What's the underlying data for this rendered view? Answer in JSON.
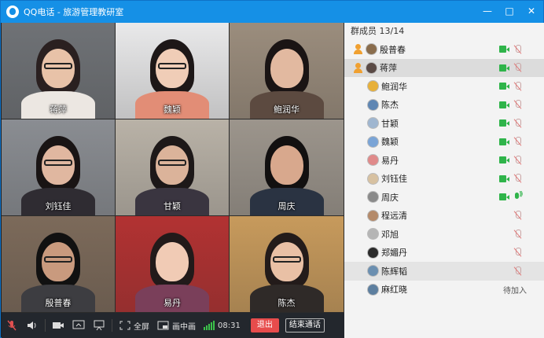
{
  "window": {
    "title": "QQ电话 - 旅游管理教研室",
    "minimize_label": "—",
    "maximize_label": "□",
    "close_label": "✕"
  },
  "tiles": [
    {
      "name": "蒋萍",
      "bg": "#6f7276",
      "skin": "#e8c2a8",
      "hair": "#2a2020",
      "shirt": "#ece7e2",
      "glasses": true
    },
    {
      "name": "魏颖",
      "bg": "#e9e9ea",
      "skin": "#f0cdb7",
      "hair": "#1d1717",
      "shirt": "#e28d76",
      "glasses": true
    },
    {
      "name": "鲍润华",
      "bg": "#9b8d7d",
      "skin": "#e2b9a0",
      "hair": "#1a1414",
      "shirt": "#5c4a40",
      "glasses": false
    },
    {
      "name": "刘钰佳",
      "bg": "#8a8d92",
      "skin": "#e0b7a0",
      "hair": "#191414",
      "shirt": "#2f2c32",
      "glasses": true
    },
    {
      "name": "甘颖",
      "bg": "#b9b2a7",
      "skin": "#dbb39a",
      "hair": "#1d1818",
      "shirt": "#3a3540",
      "glasses": true
    },
    {
      "name": "周庆",
      "bg": "#9c958c",
      "skin": "#d8a88d",
      "hair": "#121010",
      "shirt": "#2a3342",
      "glasses": false
    },
    {
      "name": "殷普春",
      "bg": "#7c6a5a",
      "skin": "#c99a7e",
      "hair": "#111",
      "shirt": "#3d3d41",
      "glasses": true
    },
    {
      "name": "易丹",
      "bg": "#b23232",
      "skin": "#f1cbb5",
      "hair": "#221a1a",
      "shirt": "#7a3f5a",
      "glasses": false
    },
    {
      "name": "陈杰",
      "bg": "#c79a5c",
      "skin": "#e9c0a5",
      "hair": "#231b1a",
      "shirt": "#2f2a28",
      "glasses": true
    }
  ],
  "toolbar": {
    "fullscreen_label": "全屏",
    "pip_label": "画中画",
    "time": "08:31",
    "exit_label": "退出",
    "end_label": "结束通话"
  },
  "panel": {
    "header": "群成员 13/14",
    "members": [
      {
        "name": "殷普春",
        "host": true,
        "cam": true,
        "mic": "off",
        "avatar": "#8a6d4d"
      },
      {
        "name": "蒋萍",
        "host": true,
        "cam": true,
        "mic": "off",
        "avatar": "#5a4a45",
        "selected": true
      },
      {
        "name": "鲍润华",
        "host": false,
        "cam": true,
        "mic": "off",
        "avatar": "#e7b03a"
      },
      {
        "name": "陈杰",
        "host": false,
        "cam": true,
        "mic": "off",
        "avatar": "#5f86b3"
      },
      {
        "name": "甘颖",
        "host": false,
        "cam": true,
        "mic": "off",
        "avatar": "#9fb6d0"
      },
      {
        "name": "魏颖",
        "host": false,
        "cam": true,
        "mic": "off",
        "avatar": "#7aa4d6"
      },
      {
        "name": "易丹",
        "host": false,
        "cam": true,
        "mic": "off",
        "avatar": "#e08a8a"
      },
      {
        "name": "刘钰佳",
        "host": false,
        "cam": true,
        "mic": "off",
        "avatar": "#d7c1a1"
      },
      {
        "name": "周庆",
        "host": false,
        "cam": true,
        "mic": "on",
        "avatar": "#8a8a8a"
      },
      {
        "name": "程远清",
        "host": false,
        "cam": false,
        "mic": "off",
        "avatar": "#b48a6a"
      },
      {
        "name": "邓旭",
        "host": false,
        "cam": false,
        "mic": "off",
        "avatar": "#b5b5b5"
      },
      {
        "name": "郑媚丹",
        "host": false,
        "cam": false,
        "mic": "off",
        "avatar": "#2b2b2b"
      },
      {
        "name": "陈辉韬",
        "host": false,
        "cam": false,
        "mic": "off",
        "avatar": "#6b8fb0",
        "hover": true
      },
      {
        "name": "麻红晓",
        "host": false,
        "cam": false,
        "mic": "none",
        "avatar": "#5d7f9f",
        "pending": "待加入"
      }
    ]
  }
}
